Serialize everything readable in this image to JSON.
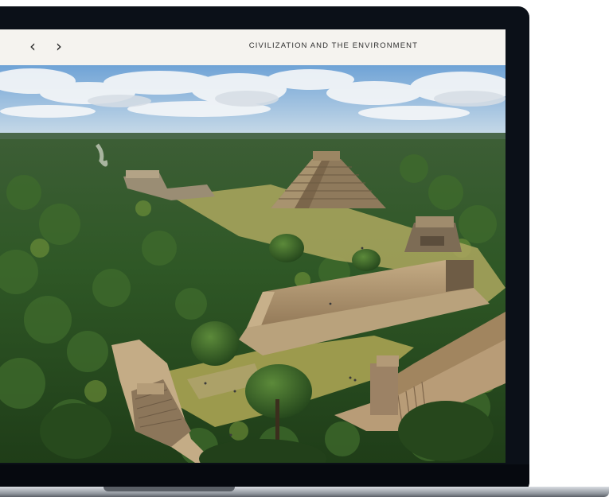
{
  "header": {
    "prev_icon": "chevron-left-icon",
    "prev_glyph": "‹",
    "next_icon": "chevron-right-icon",
    "next_glyph": "›",
    "chapter_title": "CIVILIZATION AND THE ENVIRONMENT"
  },
  "image": {
    "subject": "aerial-photo",
    "palette": {
      "sky": "#8fb8dc",
      "forest": "#2f5a24",
      "grass": "#a8a35a",
      "stone": "#a88f6e"
    }
  },
  "device": {
    "bezel_color": "#0b1018",
    "screen_bg": "#f5f3ef"
  }
}
